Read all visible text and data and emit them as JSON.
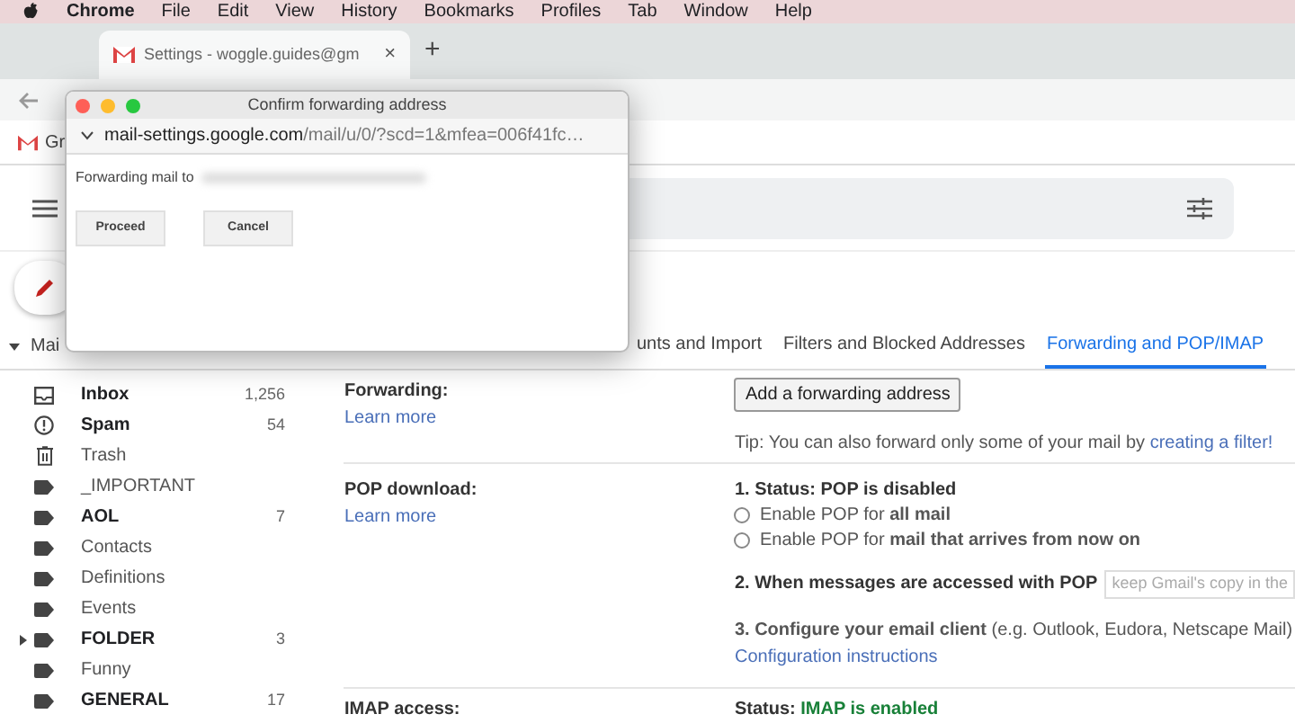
{
  "menu_bar": {
    "app": "Chrome",
    "items": [
      "File",
      "Edit",
      "View",
      "History",
      "Bookmarks",
      "Profiles",
      "Tab",
      "Window",
      "Help"
    ]
  },
  "browser_tab": {
    "title": "Settings - woggle.guides@gm",
    "close": "×",
    "new_tab": "+"
  },
  "bookmarks_bar": {
    "items": [
      "Gr"
    ]
  },
  "dialog": {
    "title": "Confirm forwarding address",
    "url_host": "mail-settings.google.com",
    "url_path": "/mail/u/0/?scd=1&mfea=006f41fc…",
    "message": "Forwarding mail to",
    "buttons": [
      "Proceed",
      "Cancel"
    ]
  },
  "mail_header": {
    "label": "Mai",
    "expanded": true
  },
  "settings_tabs": [
    {
      "label": "unts and Import",
      "selected": false
    },
    {
      "label": "Filters and Blocked Addresses",
      "selected": false
    },
    {
      "label": "Forwarding and POP/IMAP",
      "selected": true
    }
  ],
  "sidebar": {
    "items": [
      {
        "kind": "inbox",
        "label": "Inbox",
        "count": "1,256",
        "bold": true
      },
      {
        "kind": "spam",
        "label": "Spam",
        "count": "54",
        "bold": true
      },
      {
        "kind": "trash",
        "label": "Trash",
        "bold": false
      },
      {
        "kind": "label",
        "label": "_IMPORTANT",
        "bold": false
      },
      {
        "kind": "label",
        "label": "AOL",
        "count": "7",
        "bold": true
      },
      {
        "kind": "label",
        "label": "Contacts",
        "bold": false
      },
      {
        "kind": "label",
        "label": "Definitions",
        "bold": false
      },
      {
        "kind": "label",
        "label": "Events",
        "bold": false
      },
      {
        "kind": "label",
        "label": "FOLDER",
        "count": "3",
        "bold": true,
        "expanded": false
      },
      {
        "kind": "label",
        "label": "Funny",
        "bold": false
      },
      {
        "kind": "label",
        "label": "GENERAL",
        "count": "17",
        "bold": true
      }
    ]
  },
  "forwarding": {
    "label": "Forwarding:",
    "link": "Learn more",
    "button": "Add a forwarding address",
    "tip": "Tip: You can also forward only some of your mail by",
    "tip_link": "creating a filter!"
  },
  "pop_download": {
    "label": "POP download:",
    "link": "Learn more",
    "status": "1. Status: POP is disabled",
    "options": [
      {
        "text": "Enable POP for **all mail**",
        "selected": false
      },
      {
        "text": "Enable POP for **mail that arrives from now on**",
        "selected": false
      }
    ],
    "step2": "2. When messages are accessed with POP",
    "step2_value": "keep Gmail's copy in the",
    "step3": "**3. Configure your email client** (e.g. Outlook, Eudora, Netscape Mail)",
    "step3_link": "Configuration instructions"
  },
  "imap_access": {
    "label": "IMAP access:",
    "status_label": "Status:",
    "status_value": "IMAP is enabled"
  }
}
